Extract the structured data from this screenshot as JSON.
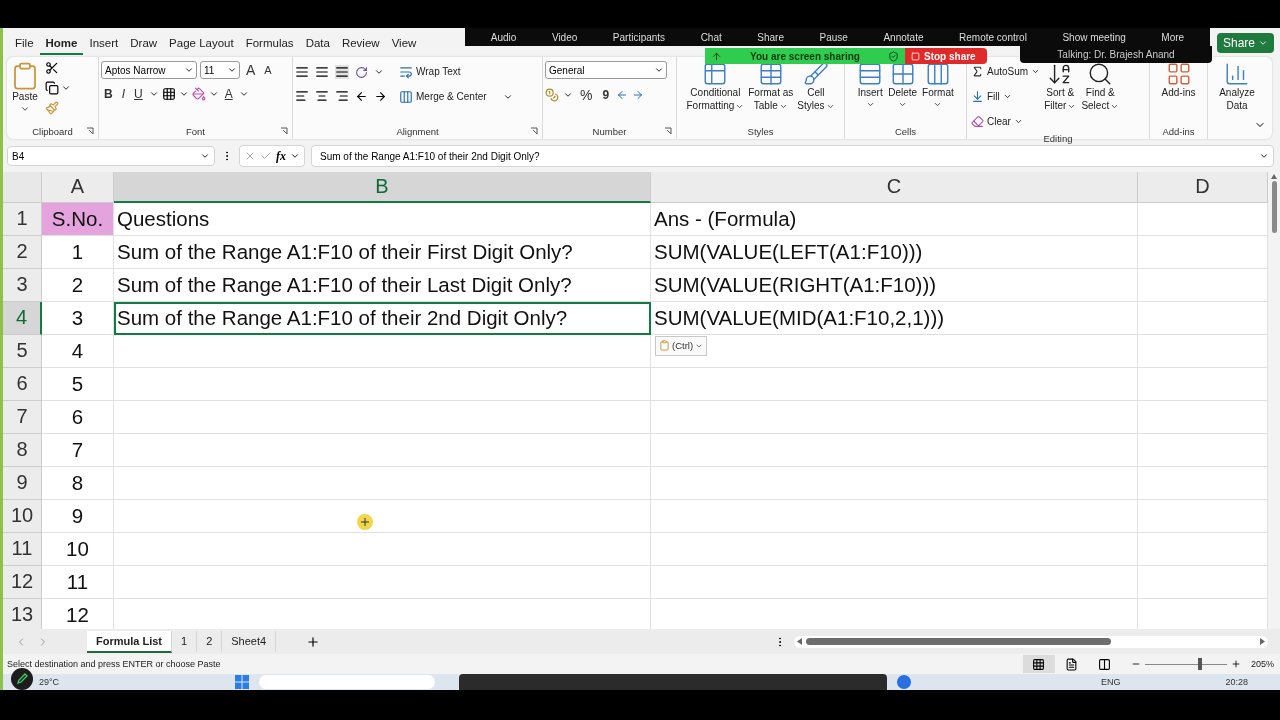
{
  "meeting_bar": {
    "items": [
      "Audio",
      "Video",
      "Participants",
      "Chat",
      "Share",
      "Pause",
      "Annotate",
      "Remote control",
      "Show meeting",
      "More"
    ],
    "sharing_banner": "You are screen sharing",
    "stop_button": "Stop share",
    "talking": "Talking: Dr. Brajesh Anand"
  },
  "menu_tabs": [
    {
      "label": "File",
      "selected": false
    },
    {
      "label": "Home",
      "selected": true
    },
    {
      "label": "Insert",
      "selected": false
    },
    {
      "label": "Draw",
      "selected": false
    },
    {
      "label": "Page Layout",
      "selected": false
    },
    {
      "label": "Formulas",
      "selected": false
    },
    {
      "label": "Data",
      "selected": false
    },
    {
      "label": "Review",
      "selected": false
    },
    {
      "label": "View",
      "selected": false
    }
  ],
  "share_button": "Share",
  "ribbon": {
    "groups": [
      {
        "kind": "clipboard",
        "name": "Clipboard",
        "paste": "Paste"
      },
      {
        "kind": "font",
        "name": "Font",
        "font_name": "Aptos Narrow",
        "font_size": "11",
        "grow": "A",
        "shrink": "A",
        "bold": "B",
        "italic": "I",
        "underline": "U",
        "font_color": "A"
      },
      {
        "kind": "alignment",
        "name": "Alignment",
        "wrap": "Wrap Text",
        "merge": "Merge & Center"
      },
      {
        "kind": "number",
        "name": "Number",
        "format": "General",
        "percent": "%",
        "comma": "9"
      },
      {
        "kind": "styles",
        "name": "Styles",
        "buttons": [
          {
            "line1": "Conditional",
            "line2": "Formatting"
          },
          {
            "line1": "Format as",
            "line2": "Table"
          },
          {
            "line1": "Cell",
            "line2": "Styles"
          }
        ]
      },
      {
        "kind": "cells",
        "name": "Cells",
        "buttons": [
          "Insert",
          "Delete",
          "Format"
        ]
      },
      {
        "kind": "editing",
        "name": "Editing",
        "small": [
          "AutoSum",
          "Fill",
          "Clear"
        ],
        "big": [
          {
            "line1": "Sort &",
            "line2": "Filter"
          },
          {
            "line1": "Find &",
            "line2": "Select"
          }
        ]
      },
      {
        "kind": "addins",
        "name": "Add-ins",
        "label": "Add-ins"
      },
      {
        "kind": "analyze",
        "line1": "Analyze",
        "line2": "Data"
      }
    ]
  },
  "formula_bar": {
    "name_box": "B4",
    "fx": "fx",
    "content": "Sum of the Range A1:F10 of their 2nd Digit Only?"
  },
  "columns": [
    {
      "label": "A",
      "selected": false
    },
    {
      "label": "B",
      "selected": true
    },
    {
      "label": "C",
      "selected": false
    },
    {
      "label": "D",
      "selected": false
    }
  ],
  "rows": [
    {
      "header": "1",
      "selected": false,
      "cells": [
        {
          "text": "S.No.",
          "selected": false,
          "color": "#e4a3dc"
        },
        {
          "text": "Questions",
          "selected": false
        },
        {
          "text": "Ans - (Formula)",
          "selected": false
        },
        {
          "selected": false
        }
      ]
    },
    {
      "header": "2",
      "selected": false,
      "cells": [
        {
          "text": "1",
          "selected": false
        },
        {
          "text": "Sum of the Range A1:F10 of their First Digit Only?",
          "selected": false
        },
        {
          "text": "SUM(VALUE(LEFT(A1:F10)))",
          "selected": false
        },
        {
          "selected": false
        }
      ]
    },
    {
      "header": "3",
      "selected": false,
      "cells": [
        {
          "text": "2",
          "selected": false
        },
        {
          "text": "Sum of the Range A1:F10 of their Last Digit Only?",
          "selected": false
        },
        {
          "text": "SUM(VALUE(RIGHT(A1:F10)))",
          "selected": false
        },
        {
          "selected": false
        }
      ]
    },
    {
      "header": "4",
      "selected": true,
      "cells": [
        {
          "text": "3",
          "selected": false
        },
        {
          "text": "Sum of the Range A1:F10 of their 2nd Digit Only?",
          "selected": true
        },
        {
          "text": "SUM(VALUE(MID(A1:F10,2,1)))",
          "selected": false
        },
        {
          "selected": false
        }
      ]
    },
    {
      "header": "5",
      "selected": false,
      "cells": [
        {
          "text": "4",
          "selected": false
        },
        {
          "selected": false
        },
        {
          "selected": false
        },
        {
          "selected": false
        }
      ]
    },
    {
      "header": "6",
      "selected": false,
      "cells": [
        {
          "text": "5",
          "selected": false
        },
        {
          "selected": false
        },
        {
          "selected": false
        },
        {
          "selected": false
        }
      ]
    },
    {
      "header": "7",
      "selected": false,
      "cells": [
        {
          "text": "6",
          "selected": false
        },
        {
          "selected": false
        },
        {
          "selected": false
        },
        {
          "selected": false
        }
      ]
    },
    {
      "header": "8",
      "selected": false,
      "cells": [
        {
          "text": "7",
          "selected": false
        },
        {
          "selected": false
        },
        {
          "selected": false
        },
        {
          "selected": false
        }
      ]
    },
    {
      "header": "9",
      "selected": false,
      "cells": [
        {
          "text": "8",
          "selected": false
        },
        {
          "selected": false
        },
        {
          "selected": false
        },
        {
          "selected": false
        }
      ]
    },
    {
      "header": "10",
      "selected": false,
      "cells": [
        {
          "text": "9",
          "selected": false
        },
        {
          "selected": false
        },
        {
          "selected": false
        },
        {
          "selected": false
        }
      ]
    },
    {
      "header": "11",
      "selected": false,
      "cells": [
        {
          "text": "10",
          "selected": false
        },
        {
          "selected": false
        },
        {
          "selected": false
        },
        {
          "selected": false
        }
      ]
    },
    {
      "header": "12",
      "selected": false,
      "cells": [
        {
          "text": "11",
          "selected": false
        },
        {
          "selected": false
        },
        {
          "selected": false
        },
        {
          "selected": false
        }
      ]
    },
    {
      "header": "13",
      "selected": false,
      "cells": [
        {
          "text": "12",
          "selected": false
        },
        {
          "selected": false
        },
        {
          "selected": false
        },
        {
          "selected": false
        }
      ]
    }
  ],
  "paste_options": "(Ctrl)",
  "sheet_tabs": [
    {
      "label": "Formula List",
      "selected": true
    },
    {
      "label": "1",
      "selected": false
    },
    {
      "label": "2",
      "selected": false
    },
    {
      "label": "Sheet4",
      "selected": false
    }
  ],
  "status_bar": {
    "message": "Select destination and press ENTER or choose Paste",
    "views": [
      {
        "kind": "normal",
        "selected": true
      },
      {
        "kind": "page_layout",
        "selected": false
      },
      {
        "kind": "page_break",
        "selected": false
      }
    ],
    "zoom": {
      "level": 0.67,
      "reading": "205%"
    }
  },
  "taskbar": {
    "weather": "29°C",
    "language": "ENG",
    "time": "20:28"
  }
}
